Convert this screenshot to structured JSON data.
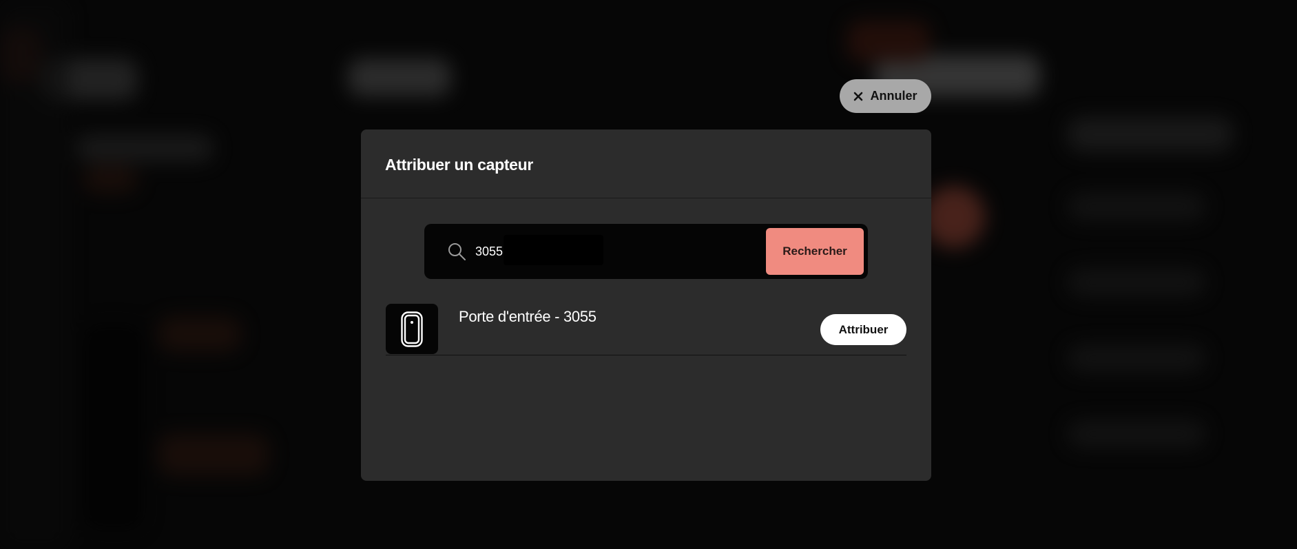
{
  "cancel": {
    "label": "Annuler",
    "icon": "close-icon"
  },
  "modal": {
    "title": "Attribuer un capteur"
  },
  "search": {
    "value": "3055",
    "placeholder": "",
    "icon": "search-icon",
    "button_label": "Rechercher"
  },
  "results": [
    {
      "name": "Porte d'entrée - 3055",
      "icon": "door-sensor-icon",
      "action_label": "Attribuer"
    }
  ],
  "colors": {
    "accent": "#f08b80",
    "modal_bg": "#2c2c2c",
    "cancel_bg": "#a8a8a8"
  }
}
